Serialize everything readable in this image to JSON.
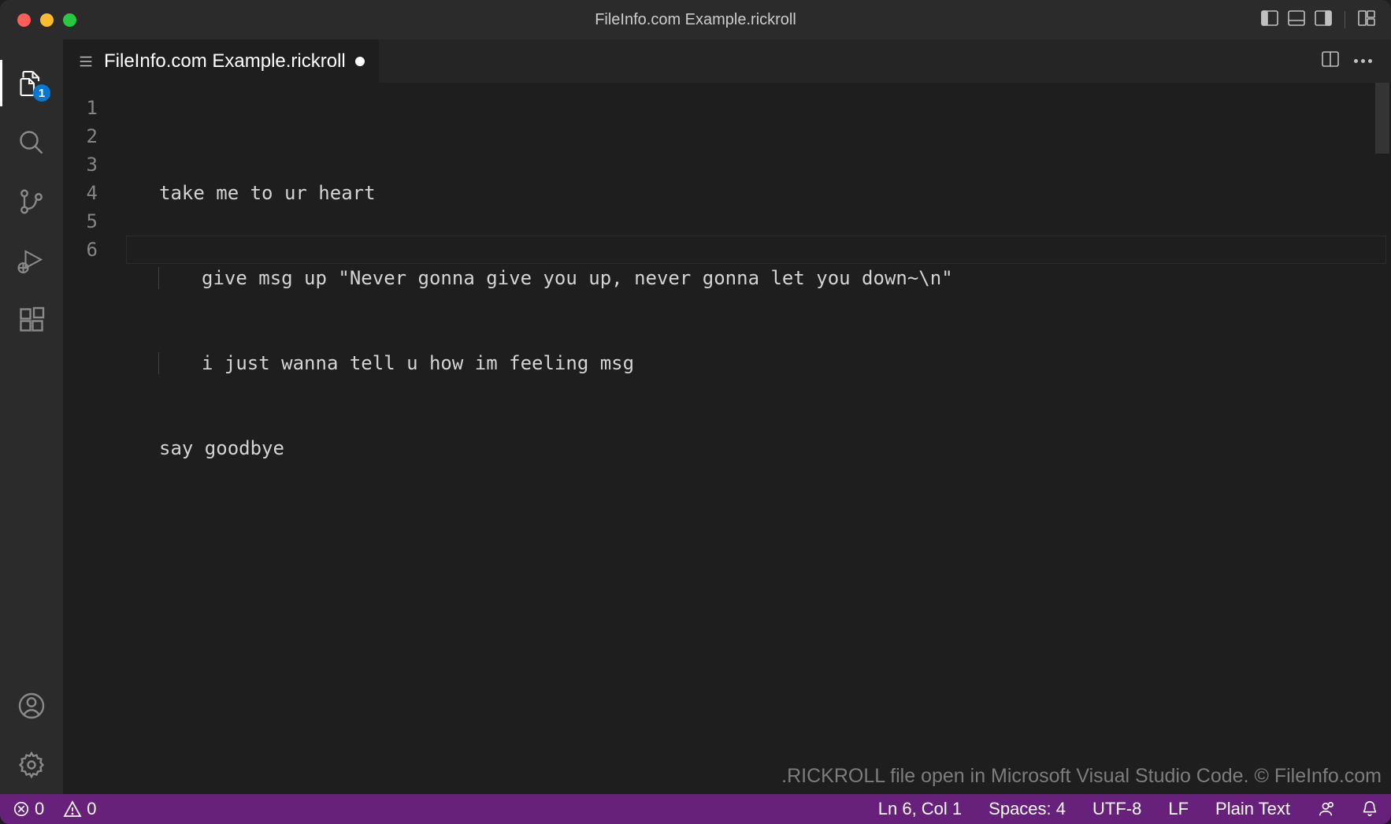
{
  "window": {
    "title": "FileInfo.com Example.rickroll"
  },
  "activitybar": {
    "explorer_badge": "1"
  },
  "tab": {
    "label": "FileInfo.com Example.rickroll"
  },
  "editor": {
    "line_numbers": [
      "1",
      "2",
      "3",
      "4",
      "5",
      "6"
    ],
    "lines": {
      "l1": "take me to ur heart",
      "l2": "give msg up \"Never gonna give you up, never gonna let you down~\\n\"",
      "l3": "i just wanna tell u how im feeling msg",
      "l4": "say goodbye",
      "l5": "",
      "l6": ""
    },
    "cursor_line_index": 5
  },
  "overlay": {
    "text": ".RICKROLL file open in Microsoft Visual Studio Code. © FileInfo.com"
  },
  "statusbar": {
    "errors": "0",
    "warnings": "0",
    "cursor": "Ln 6, Col 1",
    "indent": "Spaces: 4",
    "encoding": "UTF-8",
    "eol": "LF",
    "language": "Plain Text"
  }
}
